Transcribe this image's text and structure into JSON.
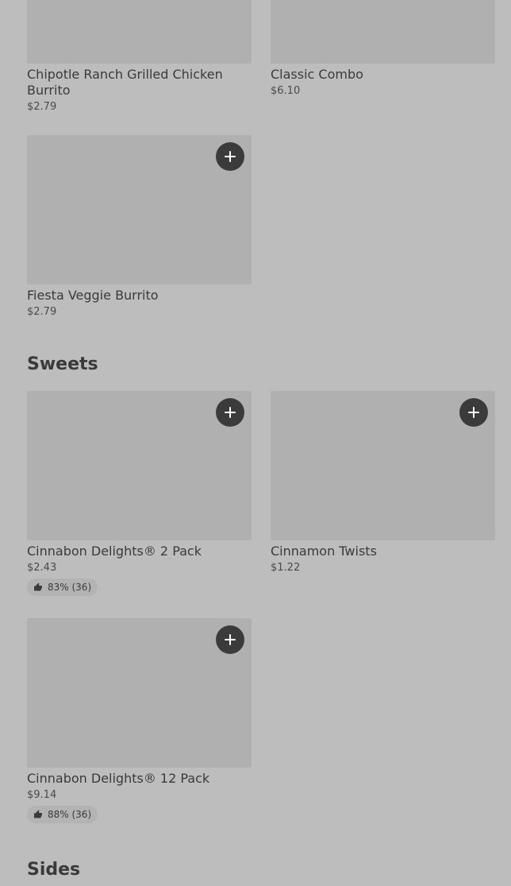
{
  "top_items": [
    {
      "name": "Chipotle Ranch Grilled Chicken Burrito",
      "price": "$2.79"
    },
    {
      "name": "Classic Combo",
      "price": "$6.10"
    },
    {
      "name": "Fiesta Veggie Burrito",
      "price": "$2.79"
    }
  ],
  "sweets": {
    "title": "Sweets",
    "items": [
      {
        "name": "Cinnabon Delights® 2 Pack",
        "price": "$2.43",
        "rating": "83% (36)"
      },
      {
        "name": "Cinnamon Twists",
        "price": "$1.22"
      },
      {
        "name": "Cinnabon Delights® 12 Pack",
        "price": "$9.14",
        "rating": "88% (36)"
      }
    ]
  },
  "sides": {
    "title": "Sides"
  },
  "icons": {
    "add": "plus-icon",
    "rating": "thumbs-up-icon"
  },
  "colors": {
    "background": "#bdbdbd",
    "image_placeholder": "#b0b0b0",
    "button": "#3b3b3b"
  }
}
